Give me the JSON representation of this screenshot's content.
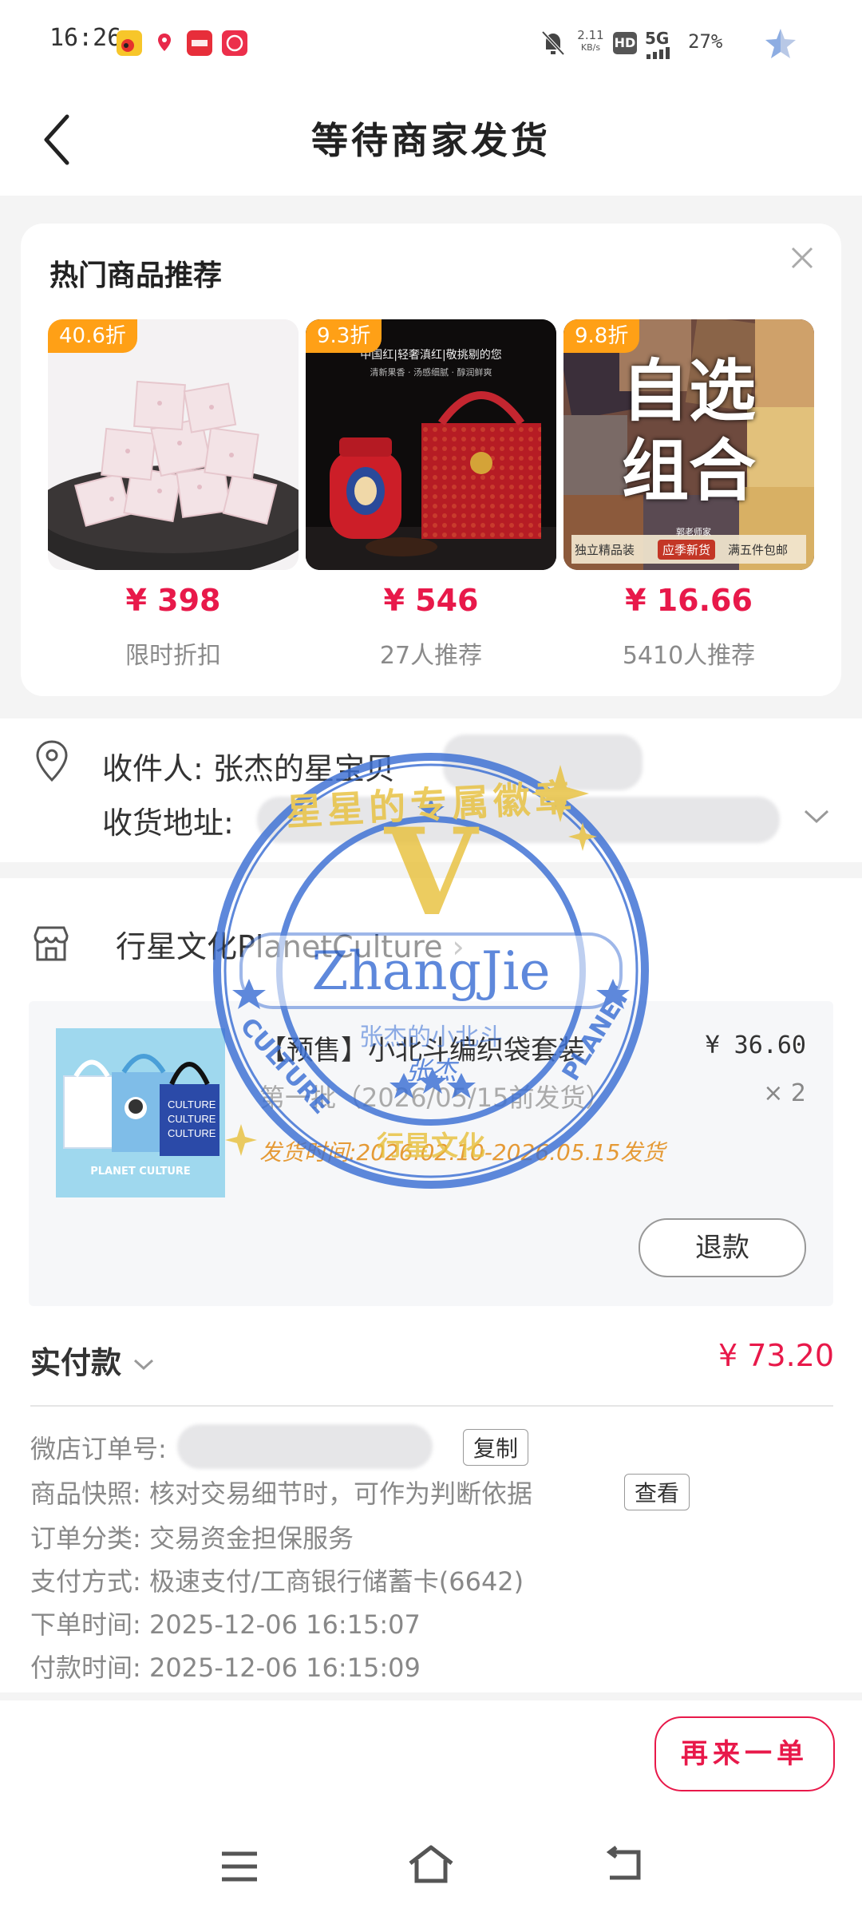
{
  "status_bar": {
    "time": "16:26",
    "speed_value": "2.11",
    "speed_unit": "KB/s",
    "hd": "HD",
    "network": "5G",
    "battery": "27%",
    "app_icons": [
      "weibo-icon",
      "map-pin-app-icon",
      "redbook-app-icon",
      "chat-app-icon"
    ]
  },
  "header": {
    "title": "等待商家发货"
  },
  "recommend": {
    "title": "热门商品推荐",
    "products": [
      {
        "discount": "40.6折",
        "price": "¥ 398",
        "subtitle": "限时折扣"
      },
      {
        "discount": "9.3折",
        "price": "¥ 546",
        "subtitle": "27人推荐",
        "image_text": "中国红|轻奢滇红|敬挑剔的您",
        "image_subtext": "清新果香 · 汤感细腻 · 醇润鲜爽"
      },
      {
        "discount": "9.8折",
        "price": "¥ 16.66",
        "subtitle": "5410人推荐",
        "image_text_line1": "自选",
        "image_text_line2": "组合",
        "tags": [
          "独立精品装",
          "应季新货",
          "满五件包邮"
        ],
        "tag_top": "郭老师家"
      }
    ]
  },
  "address": {
    "recipient_label": "收件人:",
    "recipient": "张杰的星宝贝",
    "address_label": "收货地址:"
  },
  "shop": {
    "name": "行星文化PlanetCulture",
    "item": {
      "title": "【预售】小北斗编织袋套装",
      "spec": "第一批（2026/05/15前发货）",
      "ship_time": "发货时间:2026.02.10-2026.05.15发货",
      "price": "¥ 36.60",
      "qty": "× 2",
      "thumb_text": "PLANET CULTURE"
    },
    "refund_button": "退款"
  },
  "payment": {
    "label": "实付款",
    "value": "¥ 73.20"
  },
  "order_info": {
    "order_no_label": "微店订单号:",
    "copy_button": "复制",
    "snapshot": "商品快照: 核对交易细节时，可作为判断依据",
    "view_button": "查看",
    "category": "订单分类:  交易资金担保服务",
    "payment_method": "支付方式:  极速支付/工商银行储蓄卡(6642)",
    "order_time": "下单时间:  2025-12-06 16:15:07",
    "pay_time": "付款时间:  2025-12-06 16:15:09"
  },
  "action": {
    "reorder_button": "再来一单"
  },
  "stamp": {
    "top_text": "星星的专属徽章",
    "letter": "V",
    "name": "ZhangJie",
    "side_left": "CULTURE",
    "side_right": "PLANET",
    "middle": "张杰的小北斗",
    "signature": "张杰",
    "bottom": "行星文化"
  },
  "colors": {
    "accent_red": "#e8194a",
    "discount_orange": "#ffa016",
    "stamp_blue": "#3b6fd4",
    "stamp_gold": "#e8c13e"
  }
}
